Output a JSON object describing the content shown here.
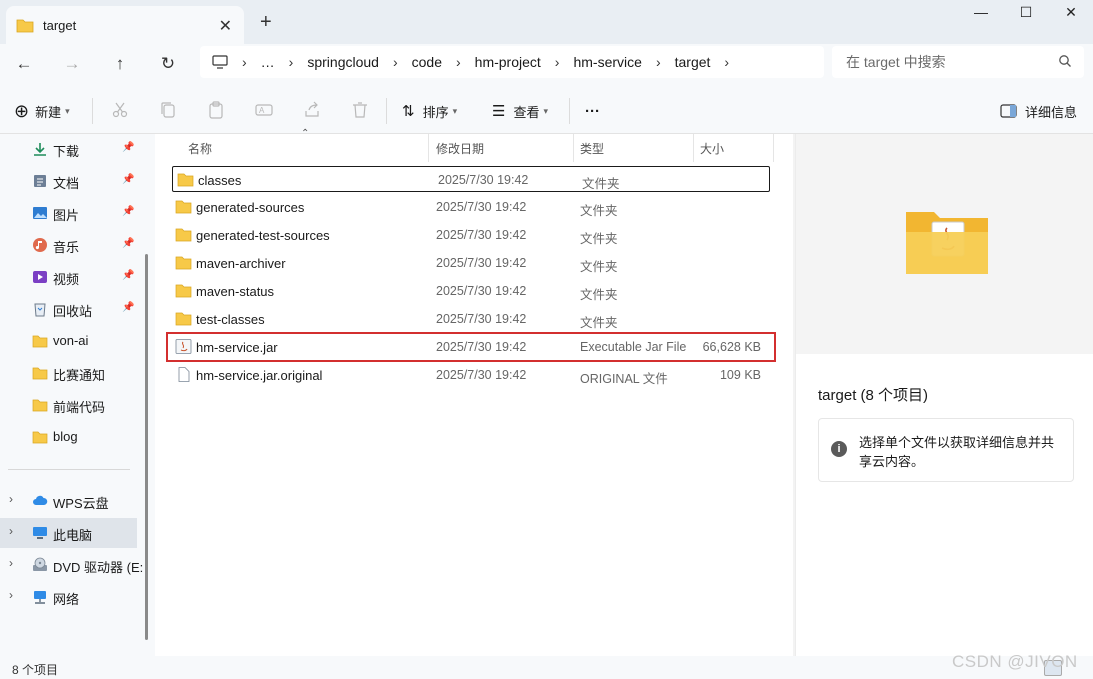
{
  "window": {
    "tab_title": "target",
    "tab_close": "✕",
    "new_tab": "+",
    "minimize": "—",
    "maximize": "☐",
    "close": "✕"
  },
  "nav": {
    "back": "←",
    "forward": "→",
    "up": "↑",
    "refresh": "↻",
    "breadcrumbs": [
      "…",
      "springcloud",
      "code",
      "hm-project",
      "hm-service",
      "target"
    ],
    "search_placeholder": "在 target 中搜索"
  },
  "commands": {
    "new_label": "新建",
    "sort_label": "排序",
    "view_label": "查看",
    "more": "···",
    "details_label": "详细信息"
  },
  "sidebar": {
    "quick_access": [
      {
        "label": "下载",
        "icon": "download-icon",
        "pinned": true
      },
      {
        "label": "文档",
        "icon": "document-icon",
        "pinned": true
      },
      {
        "label": "图片",
        "icon": "picture-icon",
        "pinned": true
      },
      {
        "label": "音乐",
        "icon": "music-icon",
        "pinned": true
      },
      {
        "label": "视频",
        "icon": "video-icon",
        "pinned": true
      },
      {
        "label": "回收站",
        "icon": "recycle-bin-icon",
        "pinned": true
      },
      {
        "label": "von-ai",
        "icon": "folder-icon",
        "pinned": false
      },
      {
        "label": "比赛通知",
        "icon": "folder-icon",
        "pinned": false
      },
      {
        "label": "前端代码",
        "icon": "folder-icon",
        "pinned": false
      },
      {
        "label": "blog",
        "icon": "folder-icon",
        "pinned": false
      }
    ],
    "locations": [
      {
        "label": "WPS云盘",
        "icon": "cloud-icon"
      },
      {
        "label": "此电脑",
        "icon": "computer-icon",
        "selected": true
      },
      {
        "label": "DVD 驱动器 (E:",
        "icon": "dvd-drive-icon"
      },
      {
        "label": "网络",
        "icon": "network-icon"
      }
    ]
  },
  "list": {
    "columns": {
      "name": "名称",
      "date": "修改日期",
      "type": "类型",
      "size": "大小"
    },
    "files": [
      {
        "name": "classes",
        "date": "2025/7/30 19:42",
        "type": "文件夹",
        "size": "",
        "kind": "folder",
        "focused": true
      },
      {
        "name": "generated-sources",
        "date": "2025/7/30 19:42",
        "type": "文件夹",
        "size": "",
        "kind": "folder"
      },
      {
        "name": "generated-test-sources",
        "date": "2025/7/30 19:42",
        "type": "文件夹",
        "size": "",
        "kind": "folder"
      },
      {
        "name": "maven-archiver",
        "date": "2025/7/30 19:42",
        "type": "文件夹",
        "size": "",
        "kind": "folder"
      },
      {
        "name": "maven-status",
        "date": "2025/7/30 19:42",
        "type": "文件夹",
        "size": "",
        "kind": "folder"
      },
      {
        "name": "test-classes",
        "date": "2025/7/30 19:42",
        "type": "文件夹",
        "size": "",
        "kind": "folder"
      },
      {
        "name": "hm-service.jar",
        "date": "2025/7/30 19:42",
        "type": "Executable Jar File",
        "size": "66,628 KB",
        "kind": "jar",
        "highlighted": true
      },
      {
        "name": "hm-service.jar.original",
        "date": "2025/7/30 19:42",
        "type": "ORIGINAL 文件",
        "size": "109 KB",
        "kind": "file"
      }
    ]
  },
  "details": {
    "title": "target (8 个项目)",
    "info": "选择单个文件以获取详细信息并共享云内容。"
  },
  "status": {
    "count": "8 个项目",
    "watermark": "CSDN @JIVON"
  },
  "colors": {
    "folder": "#f7c948",
    "highlight_box": "#d32f2f",
    "selected_sidebar": "#dfe4ea"
  }
}
